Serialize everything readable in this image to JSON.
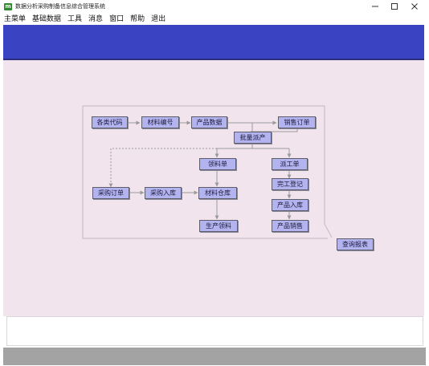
{
  "window": {
    "title": "数据分析采购制备信息综合管理系统",
    "icon_glyph": "m"
  },
  "menu": [
    "主菜单",
    "基础数据",
    "工具",
    "消息",
    "窗口",
    "帮助",
    "退出"
  ],
  "colors": {
    "banner": "#3a43c1",
    "node_fill": "#b3b3f0",
    "workspace": "#f1e4ec"
  },
  "flow": {
    "nodes": {
      "types_code": "各类代码",
      "material_no": "材料编号",
      "product_data": "产品数据",
      "sales_order": "销售订单",
      "batch_production": "批量派产",
      "material_requisition": "领料单",
      "dispatch_order": "派工单",
      "purchase_order": "采购订单",
      "purchase_receipt": "采购入库",
      "material_warehouse": "材料仓库",
      "completion_register": "完工登记",
      "product_receipt": "产品入库",
      "production_requisition": "生产领料",
      "product_sales": "产品销售",
      "query_report": "查询报表"
    }
  }
}
